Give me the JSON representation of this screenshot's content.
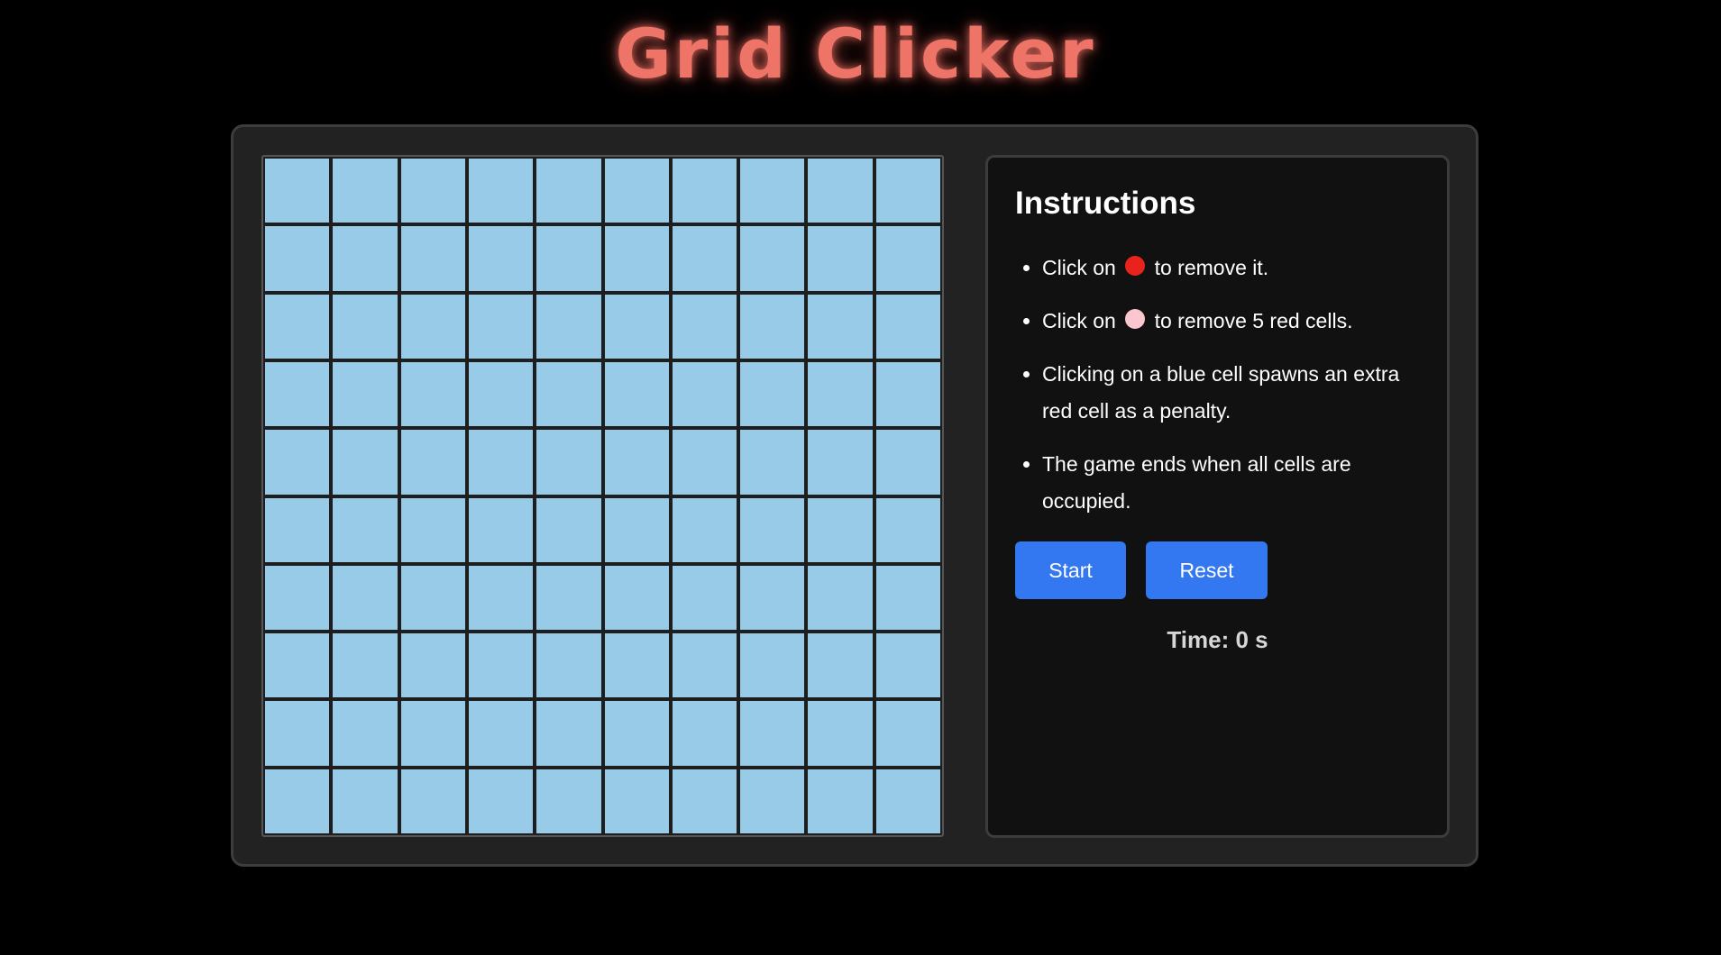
{
  "title": "Grid Clicker",
  "grid": {
    "rows": 10,
    "cols": 10,
    "cell_state": "blue",
    "cell_color": "#97cbe7"
  },
  "instructions": {
    "heading": "Instructions",
    "item1": {
      "before": "Click on",
      "icon": "red-circle",
      "after": "to remove it."
    },
    "item2": {
      "before": "Click on",
      "icon": "pink-circle",
      "after": "to remove 5 red cells."
    },
    "item3": "Clicking on a blue cell spawns an extra red cell as a penalty.",
    "item4": "The game ends when all cells are occupied."
  },
  "buttons": {
    "start": "Start",
    "reset": "Reset"
  },
  "timer": "Time: 0 s",
  "colors": {
    "title": "#ee7468",
    "red_cell": "#e8231c",
    "pink_cell": "#fbc6ce",
    "blue_cell": "#97cbe7",
    "button": "#3378f0"
  }
}
